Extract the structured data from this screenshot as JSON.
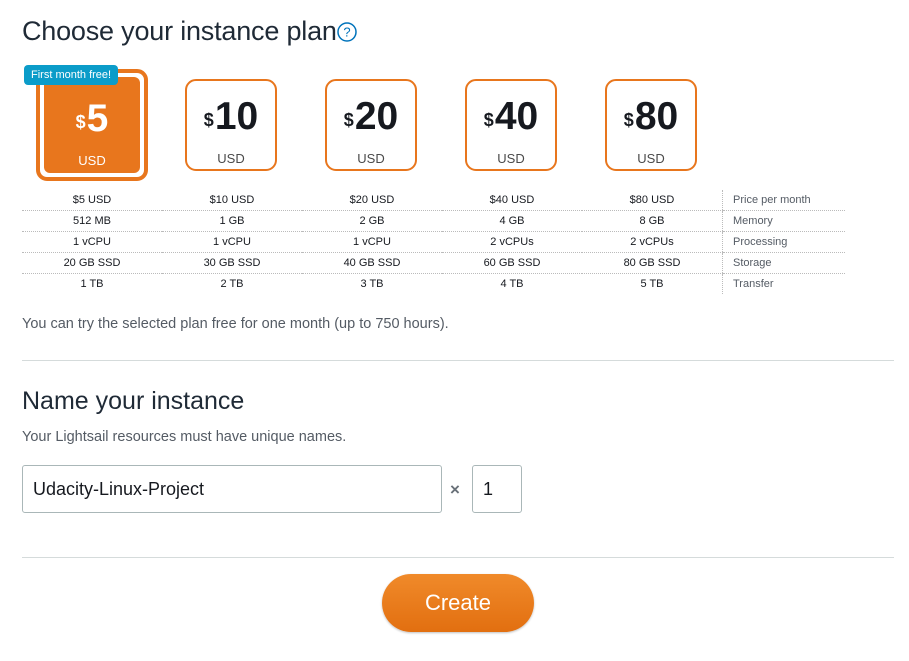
{
  "header": {
    "title": "Choose your instance plan",
    "help_icon": "question-circle-icon"
  },
  "plans": {
    "badge": "First month free!",
    "items": [
      {
        "symbol": "$",
        "amount": "5",
        "currency": "USD",
        "selected": true
      },
      {
        "symbol": "$",
        "amount": "10",
        "currency": "USD",
        "selected": false
      },
      {
        "symbol": "$",
        "amount": "20",
        "currency": "USD",
        "selected": false
      },
      {
        "symbol": "$",
        "amount": "40",
        "currency": "USD",
        "selected": false
      },
      {
        "symbol": "$",
        "amount": "80",
        "currency": "USD",
        "selected": false
      }
    ]
  },
  "specs": {
    "rows": [
      {
        "label": "Price per month",
        "values": [
          "$5 USD",
          "$10 USD",
          "$20 USD",
          "$40 USD",
          "$80 USD"
        ]
      },
      {
        "label": "Memory",
        "values": [
          "512 MB",
          "1 GB",
          "2 GB",
          "4 GB",
          "8 GB"
        ]
      },
      {
        "label": "Processing",
        "values": [
          "1 vCPU",
          "1 vCPU",
          "1 vCPU",
          "2 vCPUs",
          "2 vCPUs"
        ]
      },
      {
        "label": "Storage",
        "values": [
          "20 GB SSD",
          "30 GB SSD",
          "40 GB SSD",
          "60 GB SSD",
          "80 GB SSD"
        ]
      },
      {
        "label": "Transfer",
        "values": [
          "1 TB",
          "2 TB",
          "3 TB",
          "4 TB",
          "5 TB"
        ]
      }
    ]
  },
  "free_trial_note": "You can try the selected plan free for one month (up to 750 hours).",
  "name_section": {
    "title": "Name your instance",
    "subtitle": "Your Lightsail resources must have unique names.",
    "instance_name": "Udacity-Linux-Project",
    "multiplier_symbol": "×",
    "quantity": "1"
  },
  "actions": {
    "create_label": "Create"
  },
  "colors": {
    "accent": "#e8761d",
    "badge": "#0b9cc9",
    "link": "#0073bb"
  }
}
